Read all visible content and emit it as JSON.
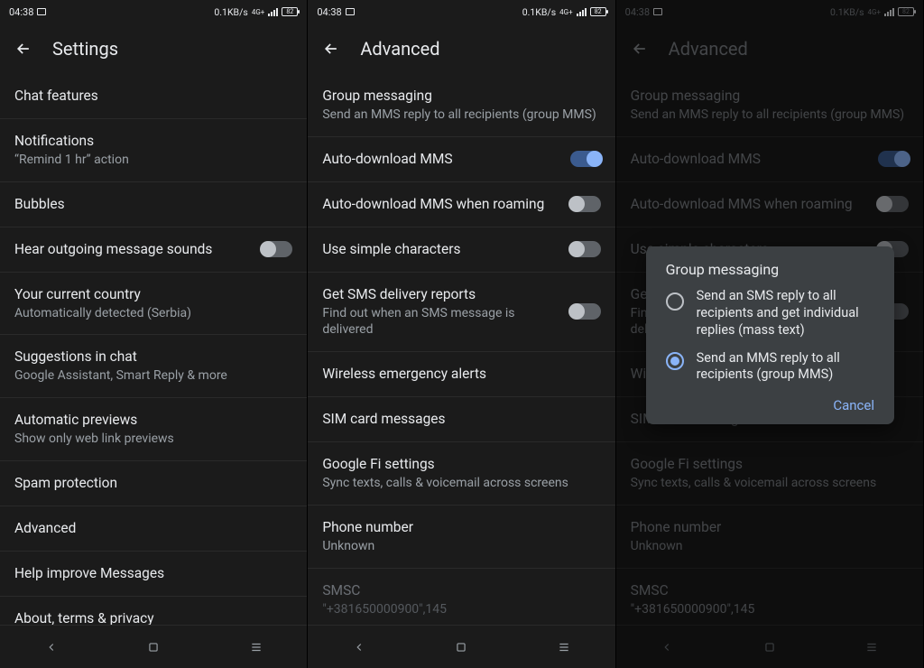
{
  "status": {
    "time": "04:38",
    "net": "0.1KB/s",
    "gen": "4G+",
    "batt": "82"
  },
  "pane1": {
    "header": "Settings",
    "items": [
      {
        "title": "Chat features"
      },
      {
        "title": "Notifications",
        "sub": "“Remind 1 hr” action"
      },
      {
        "title": "Bubbles"
      },
      {
        "title": "Hear outgoing message sounds",
        "toggle": "off"
      },
      {
        "title": "Your current country",
        "sub": "Automatically detected (Serbia)"
      },
      {
        "title": "Suggestions in chat",
        "sub": "Google Assistant, Smart Reply & more"
      },
      {
        "title": "Automatic previews",
        "sub": "Show only web link previews"
      },
      {
        "title": "Spam protection"
      },
      {
        "title": "Advanced"
      },
      {
        "title": "Help improve Messages"
      },
      {
        "title": "About, terms & privacy"
      }
    ]
  },
  "pane2": {
    "header": "Advanced",
    "items": [
      {
        "title": "Group messaging",
        "sub": "Send an MMS reply to all recipients (group MMS)"
      },
      {
        "title": "Auto-download MMS",
        "toggle": "on"
      },
      {
        "title": "Auto-download MMS when roaming",
        "toggle": "off"
      },
      {
        "title": "Use simple characters",
        "toggle": "off"
      },
      {
        "title": "Get SMS delivery reports",
        "sub": "Find out when an SMS message is delivered",
        "toggle": "off"
      },
      {
        "title": "Wireless emergency alerts"
      },
      {
        "title": "SIM card messages"
      },
      {
        "title": "Google Fi settings",
        "sub": "Sync texts, calls & voicemail across screens"
      },
      {
        "title": "Phone number",
        "sub": "Unknown"
      },
      {
        "title": "SMSC",
        "sub": "\"+381650000900\",145",
        "faded": true
      }
    ]
  },
  "pane3": {
    "header": "Advanced",
    "items": [
      {
        "title": "Group messaging",
        "sub": "Send an MMS reply to all recipients (group MMS)"
      },
      {
        "title": "Auto-download MMS",
        "toggle": "on"
      },
      {
        "title": "Auto-download MMS when roaming",
        "toggle": "off"
      },
      {
        "title": "Use simple characters",
        "toggle": "off"
      },
      {
        "title": "Get SMS delivery reports",
        "sub": "Find out when an SMS message is delivered",
        "toggle": "off"
      },
      {
        "title": "Wireless emergency alerts"
      },
      {
        "title": "SIM card messages"
      },
      {
        "title": "Google Fi settings",
        "sub": "Sync texts, calls & voicemail across screens"
      },
      {
        "title": "Phone number",
        "sub": "Unknown"
      },
      {
        "title": "SMSC",
        "sub": "\"+381650000900\",145",
        "faded": true
      }
    ],
    "dialog": {
      "title": "Group messaging",
      "options": [
        {
          "label": "Send an SMS reply to all recipients and get individual replies (mass text)",
          "selected": false,
          "clipped": true
        },
        {
          "label": "Send an MMS reply to all recipients (group MMS)",
          "selected": true
        }
      ],
      "cancel": "Cancel"
    }
  }
}
